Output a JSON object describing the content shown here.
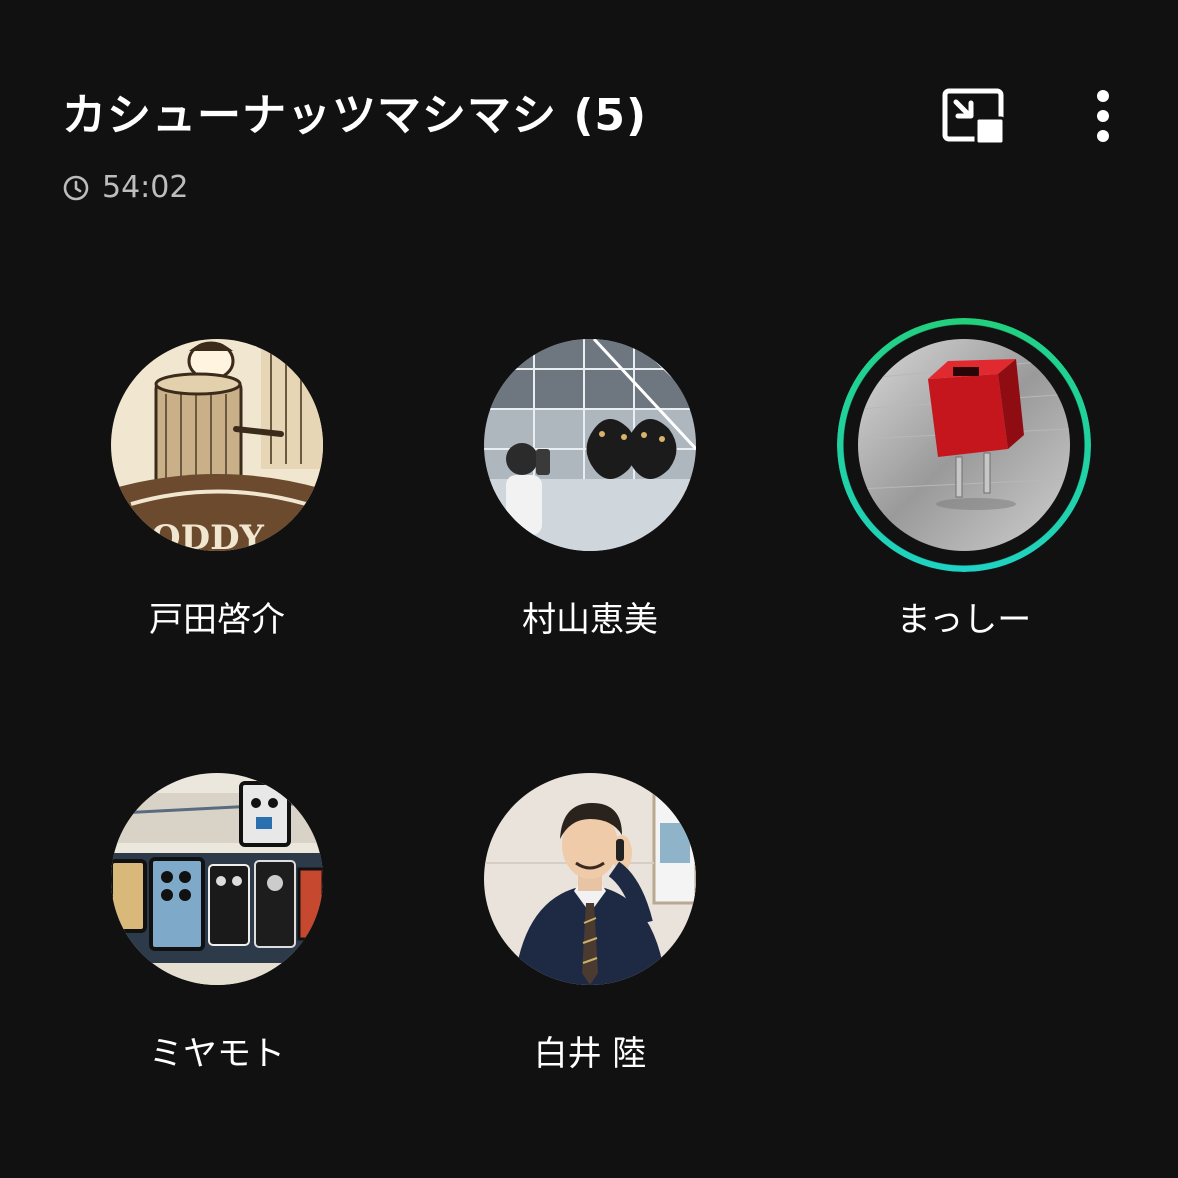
{
  "header": {
    "title": "カシューナッツマシマシ (5)",
    "duration": "54:02",
    "icons": {
      "clock": "clock-icon",
      "pip": "picture-in-picture-icon",
      "more": "more-vertical-icon"
    }
  },
  "participants": [
    {
      "name": "戸田啓介",
      "avatar": "vintage-illustration-avatar",
      "speaking": false
    },
    {
      "name": "村山恵美",
      "avatar": "mirror-selfie-avatar",
      "speaking": false
    },
    {
      "name": "まっしー",
      "avatar": "red-usb-charger-avatar",
      "speaking": true
    },
    {
      "name": "ミヤモト",
      "avatar": "effect-pedals-drawing-avatar",
      "speaking": false
    },
    {
      "name": "白井 陸",
      "avatar": "man-in-suit-on-phone-avatar",
      "speaking": false
    }
  ],
  "colors": {
    "background": "#111111",
    "speaking_ring_start": "#22d07a",
    "speaking_ring_end": "#1fd3c8",
    "secondary_text": "#bdbdbd"
  }
}
